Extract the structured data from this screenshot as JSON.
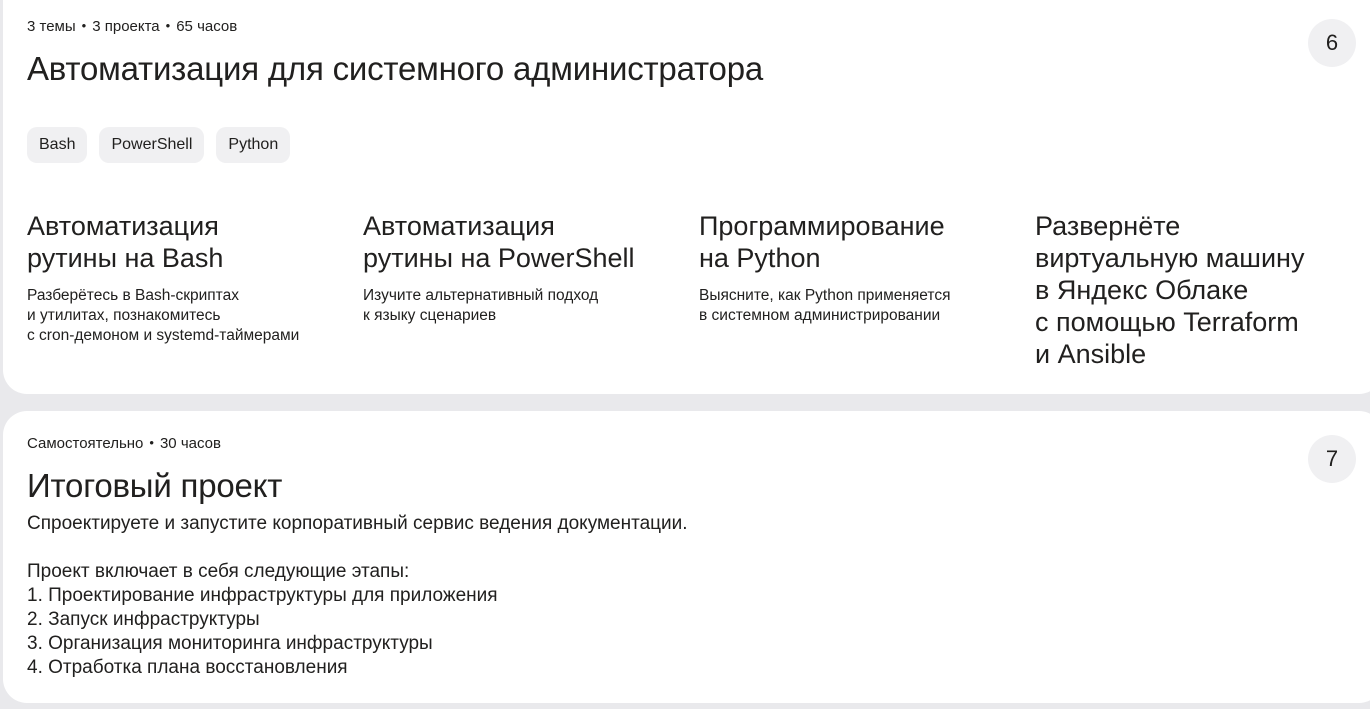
{
  "module6": {
    "number": "6",
    "meta": [
      "3 темы",
      "3 проекта",
      "65 часов"
    ],
    "title": "Автоматизация для системного администратора",
    "tags": [
      "Bash",
      "PowerShell",
      "Python"
    ],
    "topics": [
      {
        "title": "Автоматизация\nрутины на Bash",
        "description": "Разберётесь в Bash-скриптах\nи утилитах, познакомитесь\nс cron-демоном и systemd-таймерами"
      },
      {
        "title": "Автоматизация\nрутины на PowerShell",
        "description": "Изучите альтернативный подход\nк языку сценариев"
      },
      {
        "title": "Программирование\nна Python",
        "description": "Выясните, как Python применяется\nв системном администрировании"
      },
      {
        "title": "Развернёте\nвиртуальную машину\nв Яндекс Облаке\nс помощью Terraform\nи Ansible",
        "description": ""
      }
    ]
  },
  "module7": {
    "number": "7",
    "meta": [
      "Самостоятельно",
      "30 часов"
    ],
    "title": "Итоговый проект",
    "description": "Спроектируете и запустите корпоративный сервис ведения документации.\n\nПроект включает в себя следующие этапы:\n1. Проектирование инфраструктуры для приложения\n2. Запуск инфраструктуры\n3. Организация мониторинга инфраструктуры\n4. Отработка плана восстановления"
  },
  "separator": "•"
}
